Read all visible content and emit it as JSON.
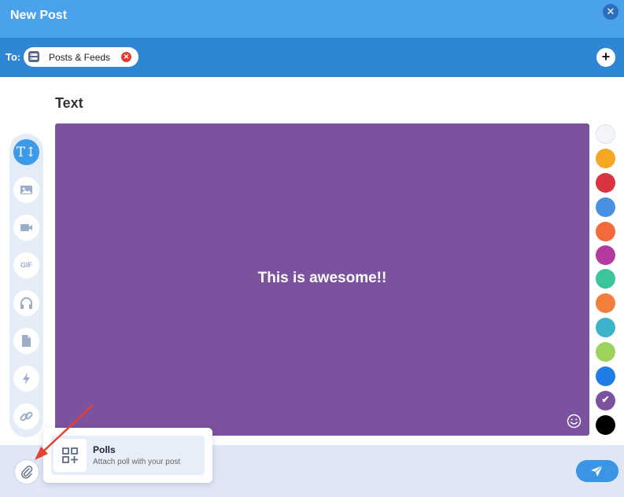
{
  "header": {
    "title": "New Post",
    "close_icon": "close-icon"
  },
  "to_bar": {
    "label": "To:",
    "recipient_chip": {
      "label": "Posts & Feeds",
      "icon": "feed-icon",
      "remove_icon": "remove-icon"
    },
    "add_icon": "plus-icon"
  },
  "editor": {
    "section_title": "Text",
    "post_text": "This is awesome!!",
    "background_color": "#7b529e",
    "emoji_icon": "smiley-icon"
  },
  "toolbar": {
    "items": [
      {
        "name": "text",
        "icon": "text-icon",
        "glyph": "T↕",
        "active": true
      },
      {
        "name": "image",
        "icon": "image-icon"
      },
      {
        "name": "video",
        "icon": "video-icon"
      },
      {
        "name": "gif",
        "icon": "gif-icon",
        "glyph": "GIF"
      },
      {
        "name": "audio",
        "icon": "headphones-icon"
      },
      {
        "name": "document",
        "icon": "document-icon"
      },
      {
        "name": "flash",
        "icon": "lightning-icon"
      },
      {
        "name": "link",
        "icon": "link-icon"
      }
    ]
  },
  "color_palette": {
    "colors": [
      "#f3f5fb",
      "#f5a623",
      "#d9343f",
      "#4a90e2",
      "#f06a3c",
      "#b53aa0",
      "#3dc49a",
      "#f07f3c",
      "#3db3c9",
      "#9dd25c",
      "#1f7de6",
      "#7b529e",
      "#000000"
    ],
    "selected": "#7b529e",
    "check_mark": "✔"
  },
  "attach_menu": {
    "items": [
      {
        "title": "Polls",
        "description": "Attach poll with your post",
        "icon": "poll-grid-icon"
      }
    ]
  },
  "footer": {
    "attach_icon": "paperclip-icon",
    "send_icon": "send-icon"
  },
  "annotation": {
    "arrow_color": "#e8402e"
  }
}
